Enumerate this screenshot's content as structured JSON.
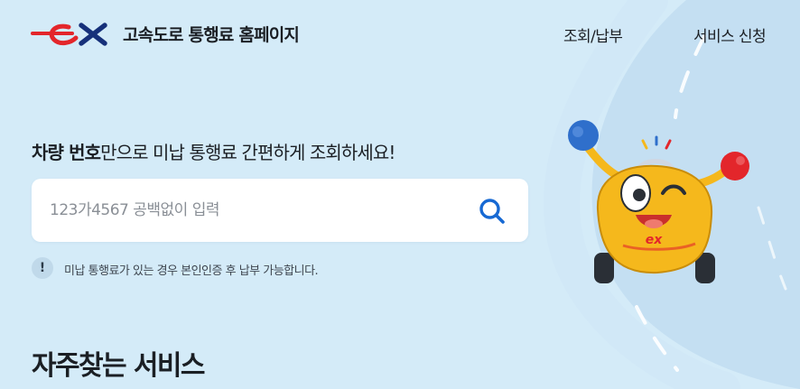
{
  "header": {
    "logo_text": "ex",
    "site_title": "고속도로 통행료 홈페이지",
    "nav": [
      {
        "label": "조회/납부"
      },
      {
        "label": "서비스 신청"
      }
    ]
  },
  "main": {
    "headline_bold": "차량 번호",
    "headline_rest": "만으로 미납 통행료 간편하게 조회하세요!",
    "search": {
      "placeholder": "123가4567 공백없이 입력",
      "value": "",
      "button_icon": "search-icon"
    },
    "notice": {
      "icon_glyph": "!",
      "text": "미납 통행료가 있는 경우 본인인증 후 납부 가능합니다."
    },
    "section_title": "자주찾는 서비스"
  },
  "mascot": {
    "badge_text": "ex"
  },
  "colors": {
    "background": "#d4ebf8",
    "road": "#c4dff2",
    "brand_red": "#e3262b",
    "brand_navy": "#16307a",
    "search_icon": "#1769d3",
    "mascot_yellow": "#f5b81c",
    "mascot_blue": "#2f6fcb"
  }
}
